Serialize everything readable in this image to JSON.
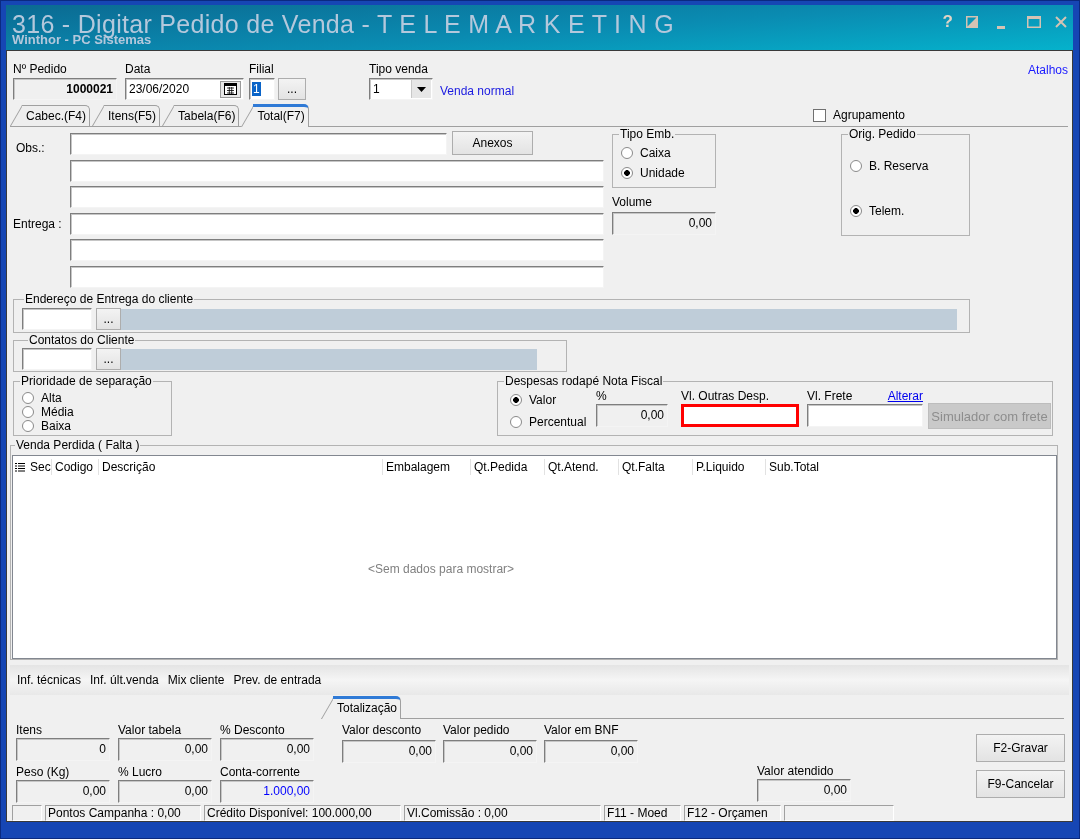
{
  "window": {
    "title": "316 - Digitar Pedido de Venda - T E L E M A R K E T I N G",
    "subtitle": "Winthor - PC Sistemas",
    "help_button": "?"
  },
  "header": {
    "order_number": {
      "label": "Nº Pedido",
      "value": "1000021"
    },
    "date": {
      "label": "Data",
      "value": "23/06/2020"
    },
    "branch": {
      "label": "Filial",
      "value": "1",
      "value_selected": true,
      "button": "..."
    },
    "sale_type": {
      "label": "Tipo venda",
      "value": "1",
      "description": "Venda normal"
    },
    "shortcuts_link": "Atalhos"
  },
  "tabs": [
    {
      "label": "Cabec.(F4)",
      "selected": false
    },
    {
      "label": "Itens(F5)",
      "selected": false
    },
    {
      "label": "Tabela(F6)",
      "selected": false
    },
    {
      "label": "Total(F7)",
      "selected": true
    }
  ],
  "grouping": {
    "label": "Agrupamento",
    "checked": false
  },
  "notes": {
    "obs_label": "Obs.:",
    "attachments_button": "Anexos",
    "delivery_label": "Entrega :"
  },
  "package_type": {
    "title": "Tipo Emb.",
    "options": [
      {
        "label": "Caixa",
        "selected": false
      },
      {
        "label": "Unidade",
        "selected": true
      }
    ]
  },
  "volume": {
    "label": "Volume",
    "value": "0,00"
  },
  "order_origin": {
    "title": "Orig. Pedido",
    "options": [
      {
        "label": "B. Reserva",
        "selected": false
      },
      {
        "label": "Telem.",
        "selected": true
      }
    ]
  },
  "delivery_address": {
    "title": "Endereço de Entrega do cliente",
    "button": "..."
  },
  "customer_contacts": {
    "title": "Contatos do Cliente",
    "button": "..."
  },
  "picking_priority": {
    "title": "Prioridade de separação",
    "options": [
      {
        "label": "Alta",
        "selected": false
      },
      {
        "label": "Média",
        "selected": false
      },
      {
        "label": "Baixa",
        "selected": false
      }
    ]
  },
  "invoice_expenses": {
    "title": "Despesas rodapé Nota Fiscal",
    "options": [
      {
        "label": "Valor",
        "selected": true
      },
      {
        "label": "Percentual",
        "selected": false
      }
    ],
    "percent": {
      "label": "%",
      "value": "0,00"
    },
    "other_expenses": {
      "label": "Vl. Outras Desp.",
      "highlighted": true
    },
    "freight": {
      "label": "Vl. Frete",
      "link": "Alterar"
    },
    "simulate_button": {
      "label": "Simulador com frete",
      "disabled": true
    }
  },
  "lost_sales": {
    "title": "Venda Perdida ( Falta )",
    "table": {
      "columns": [
        "Sec",
        "Codigo",
        "Descrição",
        "Embalagem",
        "Qt.Pedida",
        "Qt.Atend.",
        "Qt.Falta",
        "P.Liquido",
        "Sub.Total"
      ],
      "empty_message": "<Sem dados para mostrar>"
    }
  },
  "info_links": [
    "Inf. técnicas",
    "Inf. últ.venda",
    "Mix cliente",
    "Prev. de entrada"
  ],
  "totals_tabs": [
    {
      "label": "Totalização",
      "selected": true
    }
  ],
  "totals": {
    "left": [
      {
        "label": "Itens",
        "value": "0"
      },
      {
        "label": "Valor tabela",
        "value": "0,00"
      },
      {
        "label": "% Desconto",
        "value": "0,00"
      },
      {
        "label": "Peso (Kg)",
        "value": "0,00"
      },
      {
        "label": "% Lucro",
        "value": "0,00"
      },
      {
        "label": "Conta-corrente",
        "value": "1.000,00",
        "color": "#0000ff"
      }
    ],
    "middle": [
      {
        "label": "Valor desconto",
        "value": "0,00"
      },
      {
        "label": "Valor pedido",
        "value": "0,00"
      },
      {
        "label": "Valor em BNF",
        "value": "0,00"
      }
    ],
    "served": {
      "label": "Valor atendido",
      "value": "0,00"
    }
  },
  "actions": [
    "F2-Gravar",
    "F9-Cancelar"
  ],
  "status_bar": [
    "Pontos Campanha : 0,00",
    "Crédito Disponível: 100.000,00",
    "Vl.Comissão : 0,00",
    "F11 - Moed",
    "F12 - Orçamen"
  ]
}
